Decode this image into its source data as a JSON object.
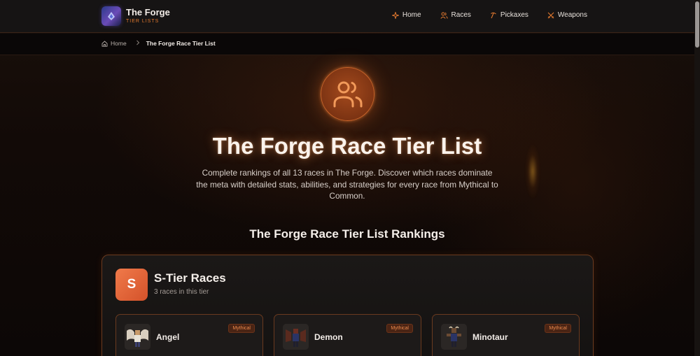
{
  "brand": {
    "title": "The Forge",
    "subtitle": "TIER LISTS"
  },
  "nav": {
    "items": [
      {
        "label": "Home",
        "icon": "sparkles-icon"
      },
      {
        "label": "Races",
        "icon": "users-icon"
      },
      {
        "label": "Pickaxes",
        "icon": "pickaxe-icon"
      },
      {
        "label": "Weapons",
        "icon": "swords-icon"
      }
    ]
  },
  "breadcrumb": {
    "home": "Home",
    "current": "The Forge Race Tier List"
  },
  "hero": {
    "title": "The Forge Race Tier List",
    "description": "Complete rankings of all 13 races in The Forge. Discover which races dominate the meta with detailed stats, abilities, and strategies for every race from Mythical to Common."
  },
  "section_title": "The Forge Race Tier List Rankings",
  "tier": {
    "badge": "S",
    "name": "S-Tier Races",
    "count": "3 races in this tier",
    "races": [
      {
        "name": "Angel",
        "rarity": "Mythical"
      },
      {
        "name": "Demon",
        "rarity": "Mythical"
      },
      {
        "name": "Minotaur",
        "rarity": "Mythical"
      }
    ]
  },
  "colors": {
    "accent": "#e0782f",
    "tier_s": "#e8623a",
    "background": "#0b0706"
  }
}
